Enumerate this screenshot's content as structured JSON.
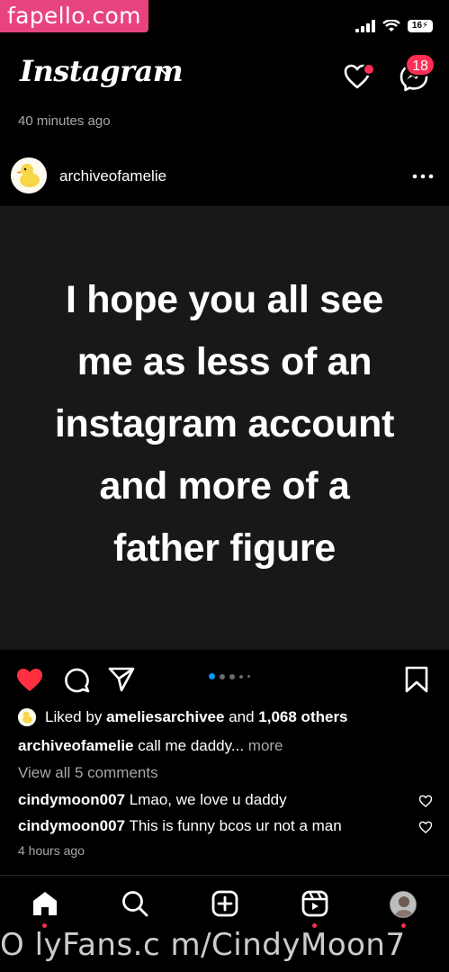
{
  "watermark": {
    "top": "fapello.com",
    "bottom": "O lyFans.c m/CindyMoon7"
  },
  "status_bar": {
    "battery": "16"
  },
  "header": {
    "app_title": "Instagram",
    "messages_badge": "18"
  },
  "feed": {
    "prev_time_ago": "40 minutes ago"
  },
  "post": {
    "username": "archiveofamelie",
    "image_text_lines": [
      "I hope you all see",
      "me as less of an",
      "instagram account",
      "and more of a",
      "father figure"
    ],
    "liked_by_prefix": "Liked by",
    "liked_by_user": "ameliesarchivee",
    "liked_by_and": "and",
    "liked_by_others": "1,068 others",
    "caption_user": "archiveofamelie",
    "caption_text": "call me daddy...",
    "caption_more": "more",
    "view_all_comments": "View all 5 comments",
    "comments": [
      {
        "user": "cindymoon007",
        "text": "Lmao, we love u daddy"
      },
      {
        "user": "cindymoon007",
        "text": "This is funny bcos ur not a man"
      }
    ],
    "time_ago": "4 hours ago"
  },
  "colors": {
    "accent_red": "#ff2e55",
    "like_red": "#ff3040",
    "carousel_active": "#0095f6",
    "muted_text": "#a8a8a8",
    "background": "#000000"
  },
  "icons": {
    "header": [
      "chevron-down-icon",
      "heart-icon",
      "messenger-icon"
    ],
    "actions": [
      "heart-filled-icon",
      "comment-icon",
      "share-icon",
      "bookmark-icon"
    ],
    "nav": [
      "home-icon",
      "search-icon",
      "create-icon",
      "reels-icon",
      "profile-avatar"
    ]
  }
}
